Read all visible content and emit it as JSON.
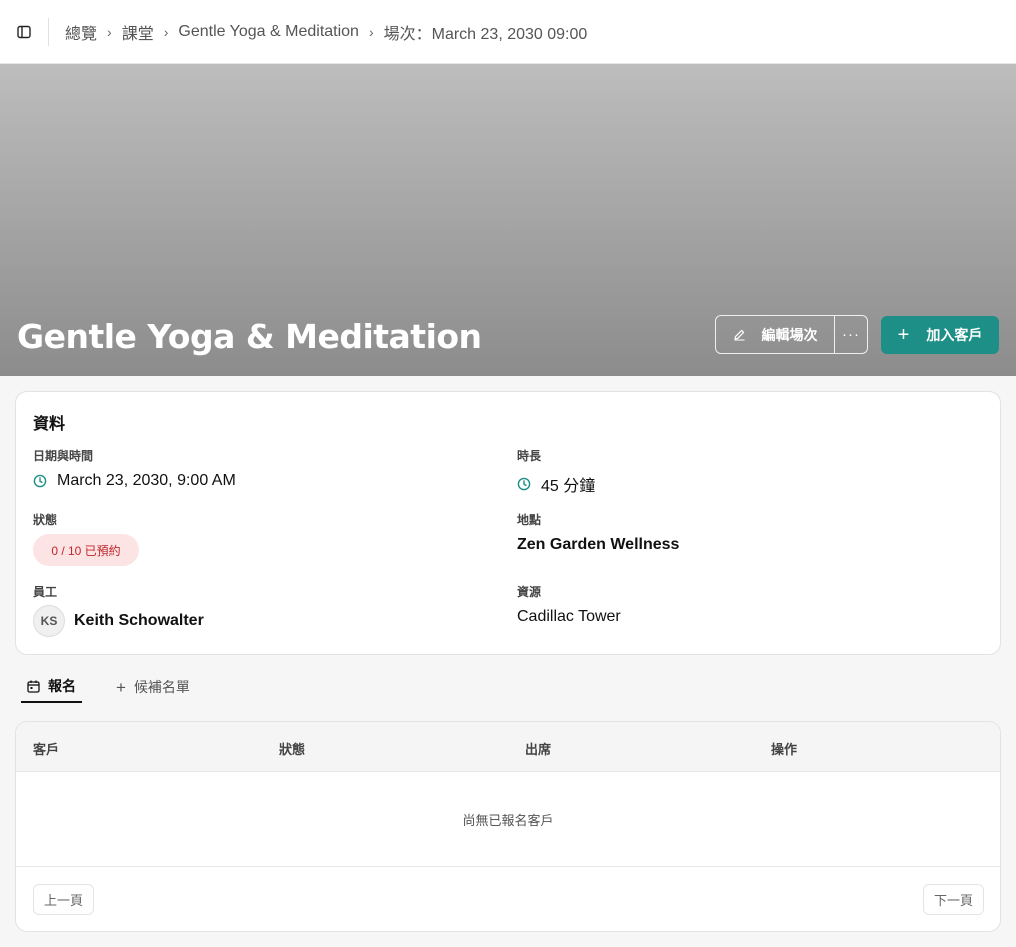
{
  "breadcrumb": {
    "items": [
      "總覽",
      "課堂",
      "Gentle Yoga & Meditation",
      "場次：March 23, 2030 09:00"
    ],
    "separator": "›"
  },
  "hero": {
    "title": "Gentle Yoga & Meditation",
    "edit_label": "編輯場次",
    "more_label": "···",
    "add_label": "加入客戶",
    "add_icon": "+"
  },
  "info": {
    "title": "資料",
    "datetime_label": "日期與時間",
    "datetime_value": "March 23, 2030, 9:00 AM",
    "duration_label": "時長",
    "duration_value": "45 分鐘",
    "status_label": "狀態",
    "status_value": "0 / 10 已預約",
    "location_label": "地點",
    "location_value": "Zen Garden Wellness",
    "staff_label": "員工",
    "staff_initials": "KS",
    "staff_name": "Keith Schowalter",
    "resource_label": "資源",
    "resource_value": "Cadillac Tower"
  },
  "tabs": {
    "enrollment": "報名",
    "waitlist": "候補名單",
    "waitlist_icon": "+"
  },
  "table": {
    "columns": [
      "客戶",
      "狀態",
      "出席",
      "操作"
    ],
    "empty_text": "尚無已報名客戶",
    "prev_label": "上一頁",
    "next_label": "下一頁"
  },
  "colors": {
    "accent": "#1e8f86",
    "status_bg": "#fde4e4",
    "status_text": "#c0262d"
  }
}
